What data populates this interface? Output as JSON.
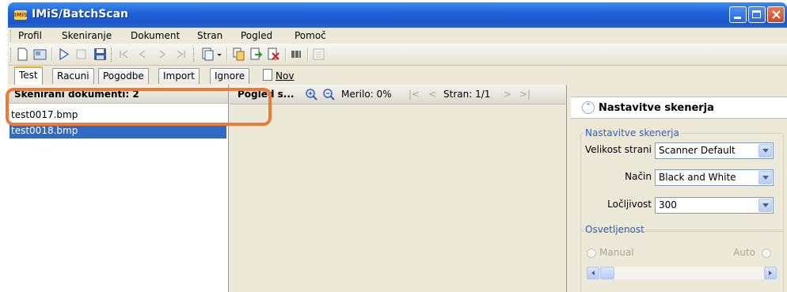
{
  "window": {
    "title": "IMiS/BatchScan",
    "app_icon_text": "IMiS"
  },
  "menu": [
    "Profil",
    "Skeniranje",
    "Dokument",
    "Stran",
    "Pogled",
    "Pomoč"
  ],
  "tabs": [
    "Test",
    "Racuni",
    "Pogodbe",
    "Import",
    "Ignore"
  ],
  "tabs_new_label": "Nov",
  "left_panel": {
    "header": "Skenirani dokumenti: 2",
    "files": [
      "test0017.bmp",
      "test0018.bmp"
    ],
    "selected_index": 1
  },
  "preview": {
    "header": "Pogled s...",
    "zoom_label": "Merilo: 0%",
    "page_label": "Stran: 1/1"
  },
  "scanner_settings": {
    "title": "Nastavitve skenerja",
    "group_title": "Nastavitve skenerja",
    "page_size_label": "Velikost strani",
    "page_size_value": "Scanner Default",
    "mode_label": "Način",
    "mode_value": "Black and White",
    "resolution_label": "Ločljivost",
    "resolution_value": "300",
    "brightness_title": "Osvetljenost",
    "manual_label": "Manual",
    "auto_label": "Auto"
  },
  "colors": {
    "selection": "#316ac5",
    "highlight": "#f07a35",
    "legend": "#2f5fbf",
    "titlebar": "#1f5fd6"
  }
}
